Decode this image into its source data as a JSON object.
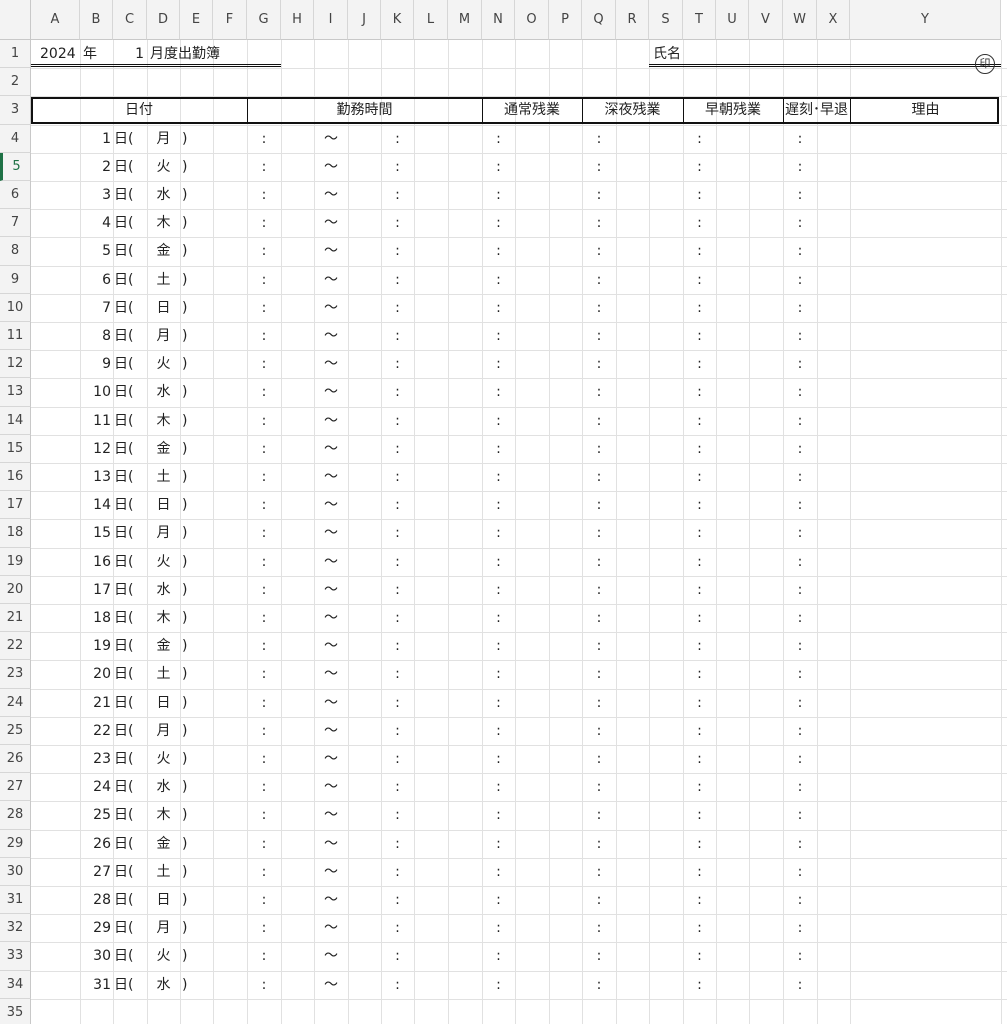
{
  "columns": [
    "A",
    "B",
    "C",
    "D",
    "E",
    "F",
    "G",
    "H",
    "I",
    "J",
    "K",
    "L",
    "M",
    "N",
    "O",
    "P",
    "Q",
    "R",
    "S",
    "T",
    "U",
    "V",
    "W",
    "X",
    "Y"
  ],
  "header": {
    "year": "2024",
    "year_suffix": "年",
    "month": "1",
    "title": "月度出勤簿",
    "name_label": "氏名",
    "seal": "印"
  },
  "table_headers": {
    "date": "日付",
    "work_hours": "勤務時間",
    "normal_overtime": "通常残業",
    "late_night_overtime": "深夜残業",
    "early_overtime": "早朝残業",
    "late_early_leave": "遅刻･早退",
    "reason": "理由"
  },
  "symbols": {
    "day_suffix": "日(",
    "close_paren": ")",
    "colon": ":",
    "tilde": "～"
  },
  "days": [
    {
      "day": "1",
      "weekday": "月"
    },
    {
      "day": "2",
      "weekday": "火"
    },
    {
      "day": "3",
      "weekday": "水"
    },
    {
      "day": "4",
      "weekday": "木"
    },
    {
      "day": "5",
      "weekday": "金"
    },
    {
      "day": "6",
      "weekday": "土"
    },
    {
      "day": "7",
      "weekday": "日"
    },
    {
      "day": "8",
      "weekday": "月"
    },
    {
      "day": "9",
      "weekday": "火"
    },
    {
      "day": "10",
      "weekday": "水"
    },
    {
      "day": "11",
      "weekday": "木"
    },
    {
      "day": "12",
      "weekday": "金"
    },
    {
      "day": "13",
      "weekday": "土"
    },
    {
      "day": "14",
      "weekday": "日"
    },
    {
      "day": "15",
      "weekday": "月"
    },
    {
      "day": "16",
      "weekday": "火"
    },
    {
      "day": "17",
      "weekday": "水"
    },
    {
      "day": "18",
      "weekday": "木"
    },
    {
      "day": "19",
      "weekday": "金"
    },
    {
      "day": "20",
      "weekday": "土"
    },
    {
      "day": "21",
      "weekday": "日"
    },
    {
      "day": "22",
      "weekday": "月"
    },
    {
      "day": "23",
      "weekday": "火"
    },
    {
      "day": "24",
      "weekday": "水"
    },
    {
      "day": "25",
      "weekday": "木"
    },
    {
      "day": "26",
      "weekday": "金"
    },
    {
      "day": "27",
      "weekday": "土"
    },
    {
      "day": "28",
      "weekday": "日"
    },
    {
      "day": "29",
      "weekday": "月"
    },
    {
      "day": "30",
      "weekday": "火"
    },
    {
      "day": "31",
      "weekday": "水"
    }
  ],
  "selected_row": 5
}
